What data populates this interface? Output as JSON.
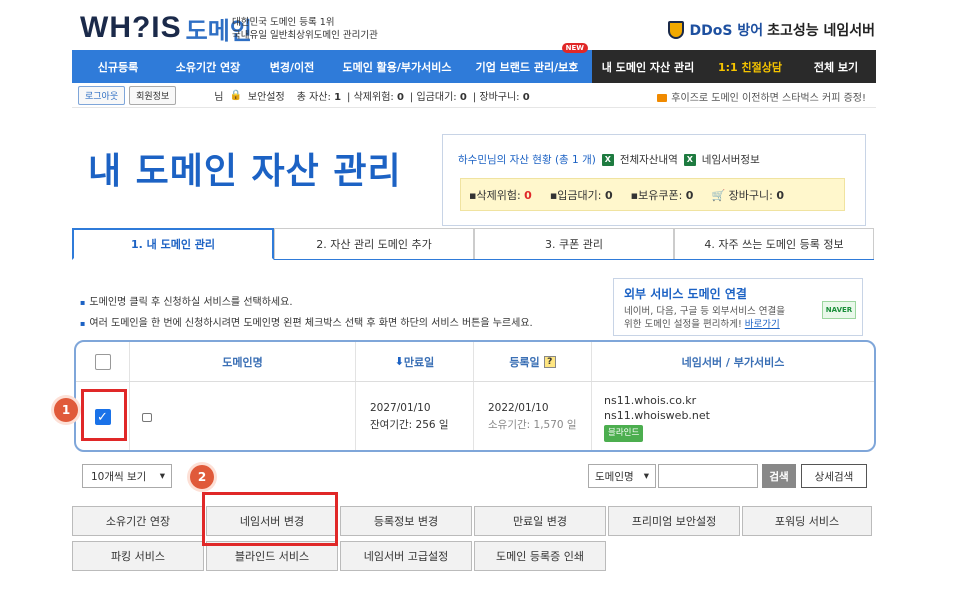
{
  "header": {
    "logo_text": "WH?IS",
    "logo_kr": "도메인",
    "logo_sub1": "대한민국 도메인 등록 1위",
    "logo_sub2": "국내유일 일반최상위도메인 관리기관",
    "ddos_blue": "DDoS 방어",
    "ddos_dark": "초고성능 네임서버"
  },
  "nav": {
    "blue_items": [
      "신규등록",
      "소유기간 연장",
      "변경/이전",
      "도메인 활용/부가서비스",
      "기업 브랜드 관리/보호"
    ],
    "new_badge": "NEW",
    "dark_items": [
      "내 도메인 자산 관리",
      "1:1 친절상담",
      "전체 보기"
    ]
  },
  "subbar": {
    "logout": "로그아웃",
    "member": "회원정보",
    "nim": "님",
    "security": "보안설정",
    "total_label": "총 자산:",
    "total_val": "1",
    "del_label": "삭제위험:",
    "del_val": "0",
    "wait_label": "입금대기:",
    "wait_val": "0",
    "cart_label": "장바구니:",
    "cart_val": "0",
    "notice": "후이즈로 도메인 이전하면 스타벅스 커피 증정!"
  },
  "page_title": "내 도메인 자산 관리",
  "status": {
    "owner_line": "하수민님의 자산 현황 (총 1 개)",
    "link1": "전체자산내역",
    "link2": "네임서버정보",
    "del_label": "삭제위험:",
    "del_val": "0",
    "wait_label": "입금대기:",
    "wait_val": "0",
    "coupon_label": "보유쿠폰:",
    "coupon_val": "0",
    "cart_label": "장바구니:",
    "cart_val": "0"
  },
  "tabs": [
    "1. 내 도메인 관리",
    "2. 자산 관리 도메인 추가",
    "3. 쿠폰 관리",
    "4. 자주 쓰는 도메인 등록 정보"
  ],
  "bullets": [
    "도메인명 클릭 후 신청하실 서비스를 선택하세요.",
    "여러 도메인을 한 번에 신청하시려면 도메인명 왼편 체크박스 선택 후 화면 하단의 서비스 버튼을 누르세요."
  ],
  "ext": {
    "title": "외부 서비스 도메인 연결",
    "desc1": "네이버, 다음, 구글 등 외부서비스 연결을",
    "desc2": "위한 도메인 설정을 편리하게!",
    "link": "바로가기",
    "naver": "NAVER"
  },
  "table": {
    "col_domain": "도메인명",
    "col_expire": "만료일",
    "col_reg": "등록일",
    "col_ns": "네임서버 / 부가서비스",
    "row": {
      "expire": "2027/01/10",
      "remain": "잔여기간: 256 일",
      "reg": "2022/01/10",
      "own": "소유기간: 1,570 일",
      "ns1": "ns11.whois.co.kr",
      "ns2": "ns11.whoisweb.net",
      "badge": "블라인드"
    }
  },
  "markers": {
    "one": "1",
    "two": "2"
  },
  "controls": {
    "page_size": "10개씩 보기",
    "search_field": "도메인명",
    "search_btn": "검색",
    "adv_btn": "상세검색"
  },
  "services": [
    "소유기간 연장",
    "네임서버 변경",
    "등록정보 변경",
    "만료일 변경",
    "프리미엄 보안설정",
    "포워딩 서비스",
    "파킹 서비스",
    "블라인드 서비스",
    "네임서버 고급설정",
    "도메인 등록증 인쇄"
  ]
}
